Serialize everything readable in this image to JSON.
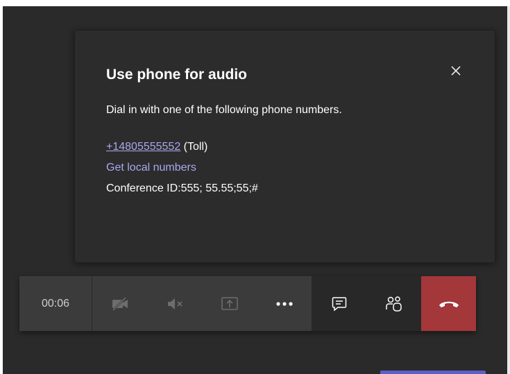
{
  "dialog": {
    "title": "Use phone for audio",
    "description": "Dial in with one of the following phone numbers.",
    "phone_number": "+14805555552",
    "phone_type": " (Toll)",
    "local_numbers_link": "Get local numbers",
    "conference_label": "Conference ID:",
    "conference_id": "555; 55.55;55;#",
    "close_icon": "close-icon"
  },
  "toolbar": {
    "timer": "00:06",
    "buttons": [
      {
        "name": "camera-off",
        "icon": "video-off-icon"
      },
      {
        "name": "mic-muted",
        "icon": "speaker-muted-icon"
      },
      {
        "name": "share",
        "icon": "share-screen-icon"
      },
      {
        "name": "more",
        "icon": "more-icon"
      },
      {
        "name": "chat",
        "icon": "chat-icon"
      },
      {
        "name": "participants",
        "icon": "people-icon"
      },
      {
        "name": "hang-up",
        "icon": "hang-up-icon"
      }
    ]
  },
  "colors": {
    "background": "#2a2a2a",
    "dialog": "#2d2c2c",
    "link": "#a7a9f0",
    "hangup": "#a4373a",
    "accent": "#5b5fc7"
  }
}
